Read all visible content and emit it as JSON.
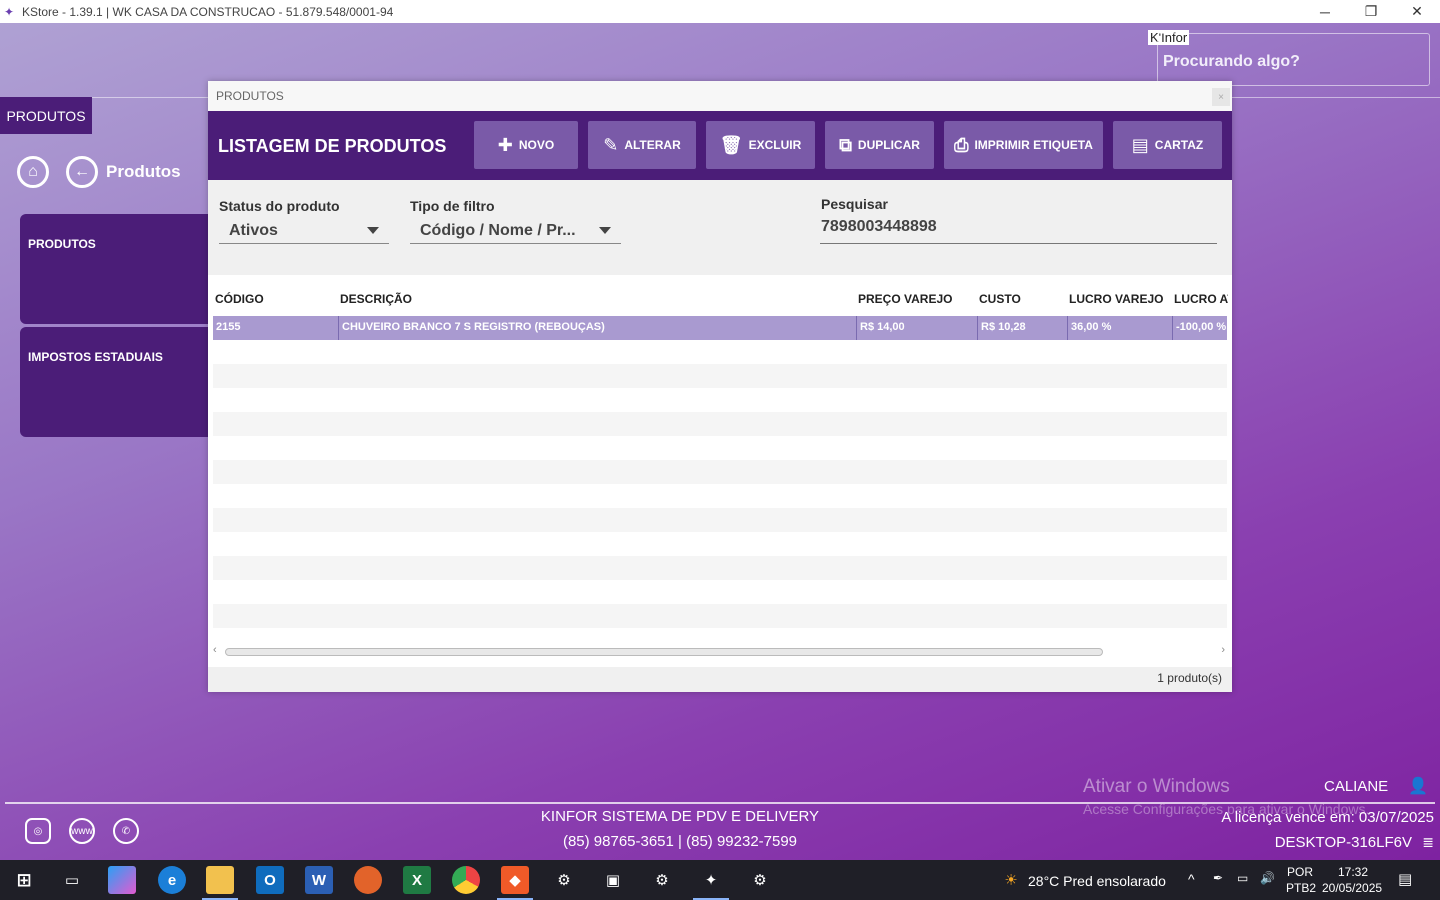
{
  "window": {
    "title": "KStore - 1.39.1  | WK CASA DA CONSTRUCAO - 51.879.548/0001-94",
    "controls": [
      "─",
      "❐",
      "✕"
    ]
  },
  "top": {
    "tooltip": "K'Infor",
    "search_placeholder": "Procurando algo?"
  },
  "nav": {
    "section_tab": "PRODUTOS",
    "breadcrumb_title": "Produtos",
    "cards": [
      "PRODUTOS",
      "IMPOSTOS ESTADUAIS"
    ]
  },
  "dialog": {
    "window_title": "PRODUTOS",
    "close": "×",
    "header_title": "LISTAGEM DE PRODUTOS",
    "toolbar": {
      "novo": "NOVO",
      "alterar": "ALTERAR",
      "excluir": "EXCLUIR",
      "duplicar": "DUPLICAR",
      "imprimir": "IMPRIMIR ETIQUETA",
      "cartaz": "CARTAZ"
    },
    "filters": {
      "status_label": "Status do produto",
      "status_value": "Ativos",
      "tipo_label": "Tipo de filtro",
      "tipo_value": "Código / Nome / Pr...",
      "pesquisar_label": "Pesquisar",
      "pesquisar_value": "7898003448898"
    },
    "table": {
      "headers": [
        "CÓDIGO",
        "DESCRIÇÃO",
        "PREÇO VAREJO",
        "CUSTO",
        "LUCRO VAREJO",
        "LUCRO AT"
      ],
      "rows": [
        [
          "2155",
          "CHUVEIRO BRANCO 7 S REGISTRO (REBOUÇAS)",
          "R$ 14,00",
          "R$ 10,28",
          "36,00 %",
          "-100,00 %"
        ]
      ]
    },
    "count": "1 produto(s)"
  },
  "footer": {
    "activate_title": "Ativar o Windows",
    "activate_sub": "Acesse Configurações para ativar o Windows.",
    "user": "CALIANE",
    "company": "KINFOR SISTEMA DE PDV E DELIVERY",
    "phones": "(85) 98765-3651 | (85) 99232-7599",
    "license": "A licença vence em: 03/07/2025",
    "machine": "DESKTOP-316LF6V"
  },
  "taskbar": {
    "weather": "28°C  Pred ensolarado",
    "lang1": "POR",
    "lang2": "PTB2",
    "time": "17:32",
    "date": "20/05/2025"
  }
}
